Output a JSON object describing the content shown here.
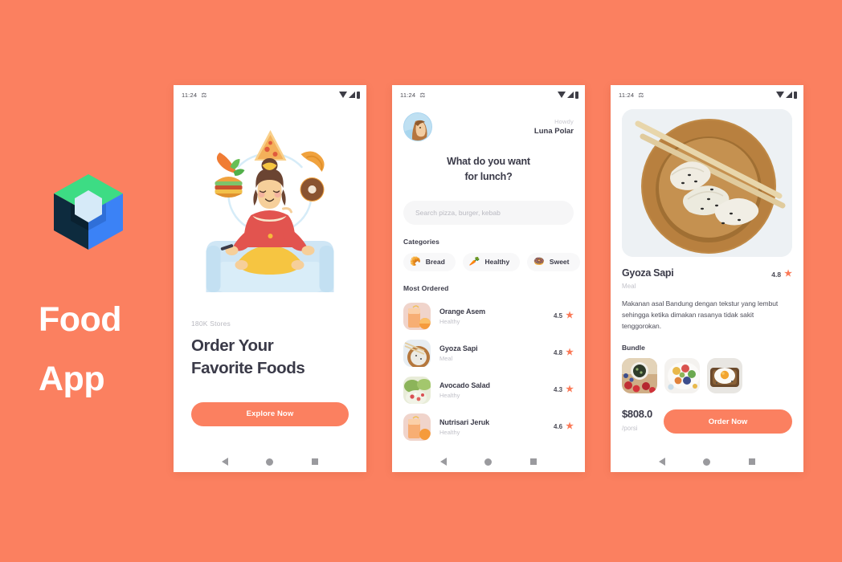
{
  "brand": {
    "title_lines": [
      "Food",
      "App"
    ],
    "logo_name": "cube-logo",
    "background_color": "#fb8060",
    "text_color": "#ffffff"
  },
  "status_bar": {
    "time": "11:24",
    "sim_icon": "sim-card-icon",
    "wifi_icon": "wifi-icon",
    "signal_icon": "signal-icon",
    "battery_icon": "battery-icon"
  },
  "nav_bar": {
    "back_icon": "back-triangle-icon",
    "home_icon": "home-circle-icon",
    "recents_icon": "recents-square-icon"
  },
  "screen1": {
    "illustration_name": "meditating-woman-with-floating-food-illustration",
    "floating_foods": [
      "pizza-slice-icon",
      "carrot-icon",
      "croissant-icon",
      "burger-icon",
      "donut-icon"
    ],
    "stores_count": "180K Stores",
    "headline_lines": [
      "Order Your",
      "Favorite Foods"
    ],
    "cta_label": "Explore Now",
    "cta_color": "#fb8060"
  },
  "screen2": {
    "avatar_name": "user-avatar",
    "greeting": "Howdy",
    "user_name": "Luna Polar",
    "question_lines": [
      "What do you want",
      "for lunch?"
    ],
    "search_placeholder": "Search pizza, burger, kebab",
    "categories_label": "Categories",
    "categories": [
      {
        "label": "Bread",
        "icon": "croissant-icon",
        "glyph": "🥐"
      },
      {
        "label": "Healthy",
        "icon": "carrot-icon",
        "glyph": "🥕"
      },
      {
        "label": "Sweet",
        "icon": "donut-icon",
        "glyph": "🍩"
      }
    ],
    "most_ordered_label": "Most Ordered",
    "most_ordered": [
      {
        "name": "Orange Asem",
        "category": "Healthy",
        "rating": "4.5",
        "thumb": "orange-drink-thumb"
      },
      {
        "name": "Gyoza Sapi",
        "category": "Meal",
        "rating": "4.8",
        "thumb": "gyoza-bowl-thumb"
      },
      {
        "name": "Avocado Salad",
        "category": "Healthy",
        "rating": "4.3",
        "thumb": "avocado-salad-thumb"
      },
      {
        "name": "Nutrisari Jeruk",
        "category": "Healthy",
        "rating": "4.6",
        "thumb": "orange-drink-thumb"
      }
    ]
  },
  "screen3": {
    "hero_photo_name": "gyoza-in-wooden-bowl-photo",
    "title": "Gyoza Sapi",
    "rating": "4.8",
    "category": "Meal",
    "description": "Makanan asal Bandung dengan tekstur yang lembut sehingga ketika dimakan rasanya tidak sakit tenggorokan.",
    "bundle_label": "Bundle",
    "bundle": [
      {
        "name": "berry-bowl-thumb"
      },
      {
        "name": "salad-plate-thumb"
      },
      {
        "name": "egg-toast-thumb"
      }
    ],
    "price": "$808.0",
    "price_unit": "/porsi",
    "order_label": "Order Now",
    "order_color": "#fb8060"
  },
  "accent": {
    "star_color": "#fb7a58",
    "primary": "#fb8060",
    "text_dark": "#3a3a48"
  }
}
